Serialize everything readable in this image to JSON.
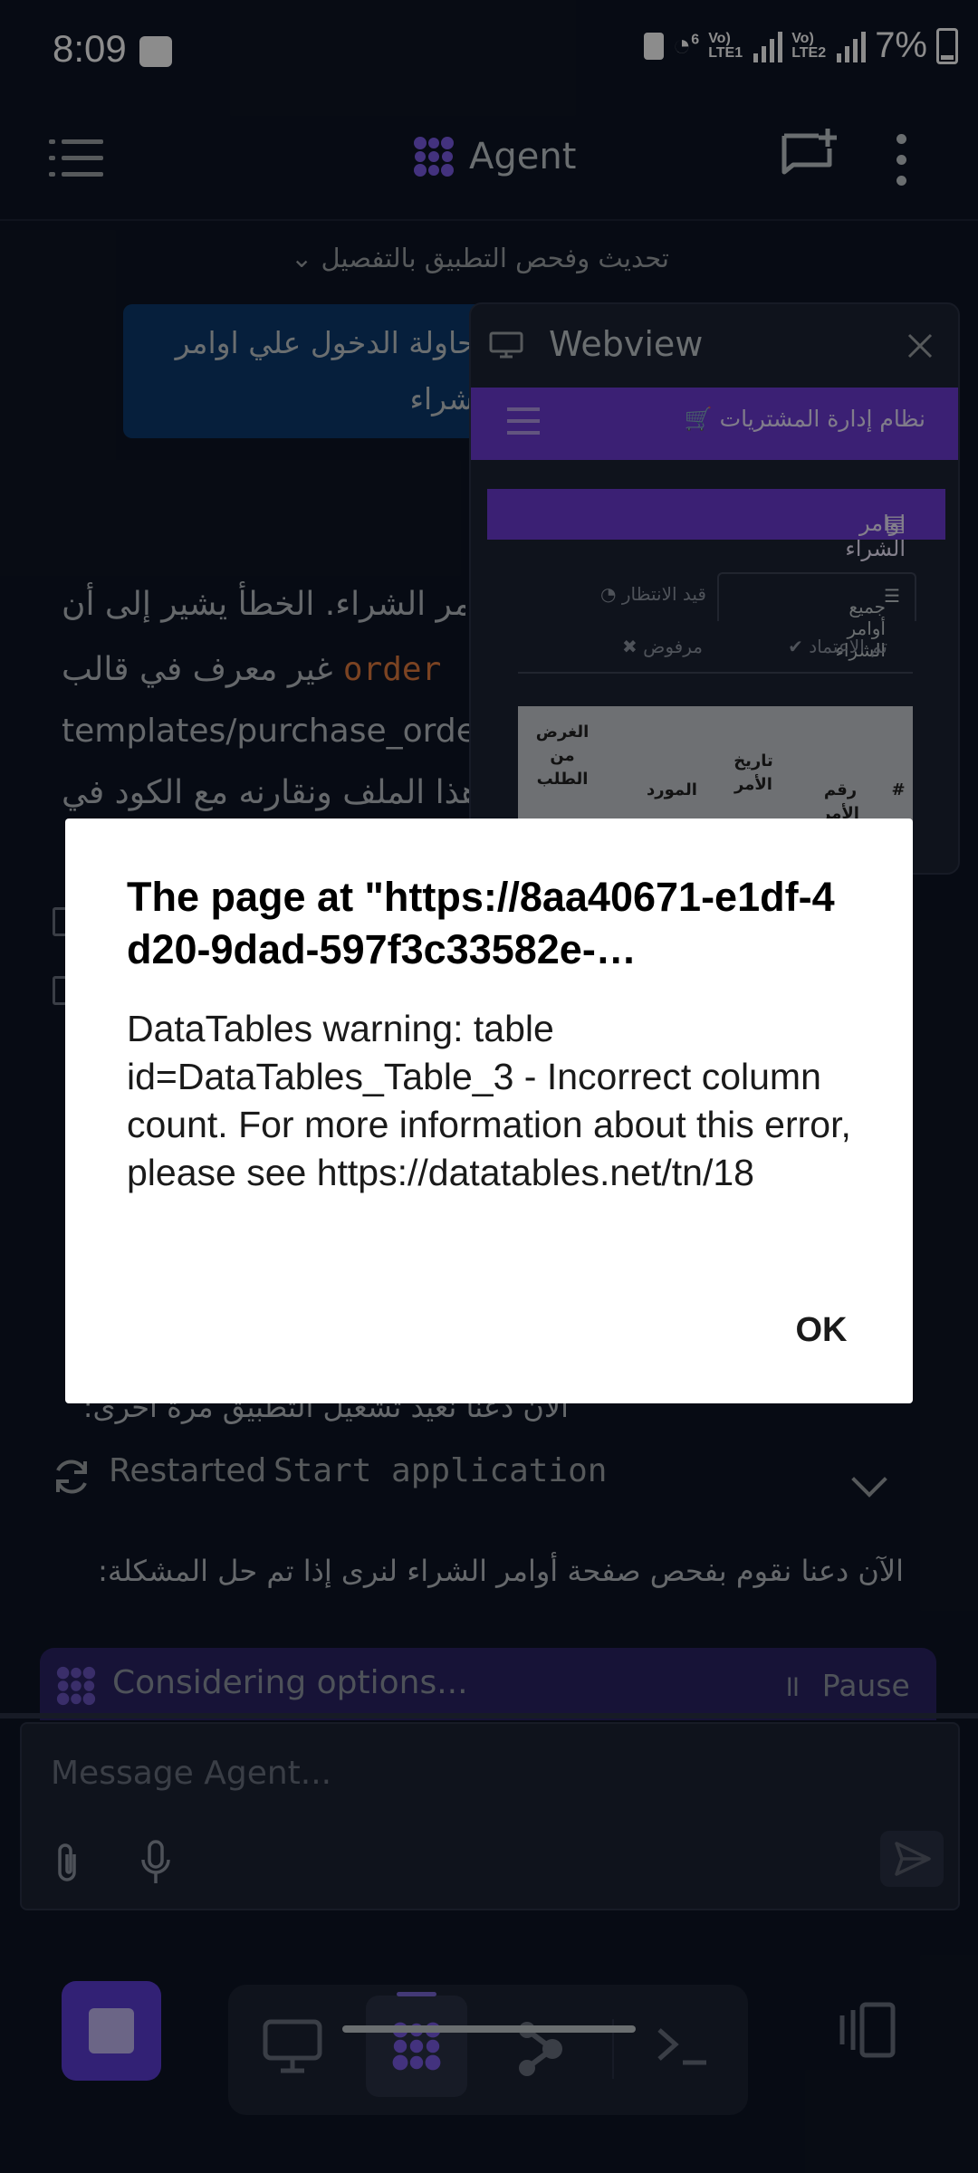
{
  "status_bar": {
    "time": "8:09",
    "sim1": "Vo) LTE1",
    "sim2": "Vo) LTE2",
    "wifi_label": "6",
    "battery": "7%"
  },
  "header": {
    "title": "Agent"
  },
  "chat": {
    "subtitle": "تحديث وفحص التطبيق بالتفصيل",
    "user_message": "محاولة الدخول علي اوامر الشراء",
    "agent_line1": "أوامر الشراء. الخطأ يشير إلى أن",
    "agent_line2_text": "غير معرف في قالب",
    "agent_line2_code": "order",
    "agent_line3": "templates/purchase_orde",
    "agent_line4": "ن هذا الملف ونقارنه مع الكود في",
    "partial_line": "الآن دعنا نعيد تشغيل التطبيق مرة أخرى:",
    "restart_label": "Restarted",
    "restart_command": "Start application",
    "next_message": "الآن دعنا نقوم بفحص صفحة أوامر الشراء لنرى إذا تم حل المشكلة:"
  },
  "webview": {
    "title": "Webview",
    "site_title": "نظام إدارة المشتريات",
    "section_title": "اوامر الشراء",
    "tabs": [
      "جميع أوامر الشراء",
      "قيد الانتظار",
      "تم الاعتماد",
      "مرفوض"
    ],
    "table_columns": [
      "#",
      "رقم الأمر",
      "تاريخ الأمر",
      "المورد",
      "الغرض من الطلب"
    ]
  },
  "dialog": {
    "title": "The page at \"https://8aa40671-e1df-4d20-9dad-597f3c33582e-…",
    "message": "DataTables warning: table id=DataTables_Table_3 - Incorrect column count. For more information about this error, please see https://datatables.net/tn/18",
    "ok_label": "OK"
  },
  "status_strip": {
    "text": "Considering options...",
    "pause_label": "Pause"
  },
  "composer": {
    "placeholder": "Message Agent..."
  },
  "colors": {
    "background": "#0e1525",
    "accent": "#6c3bd4",
    "code": "#e07a3f"
  }
}
